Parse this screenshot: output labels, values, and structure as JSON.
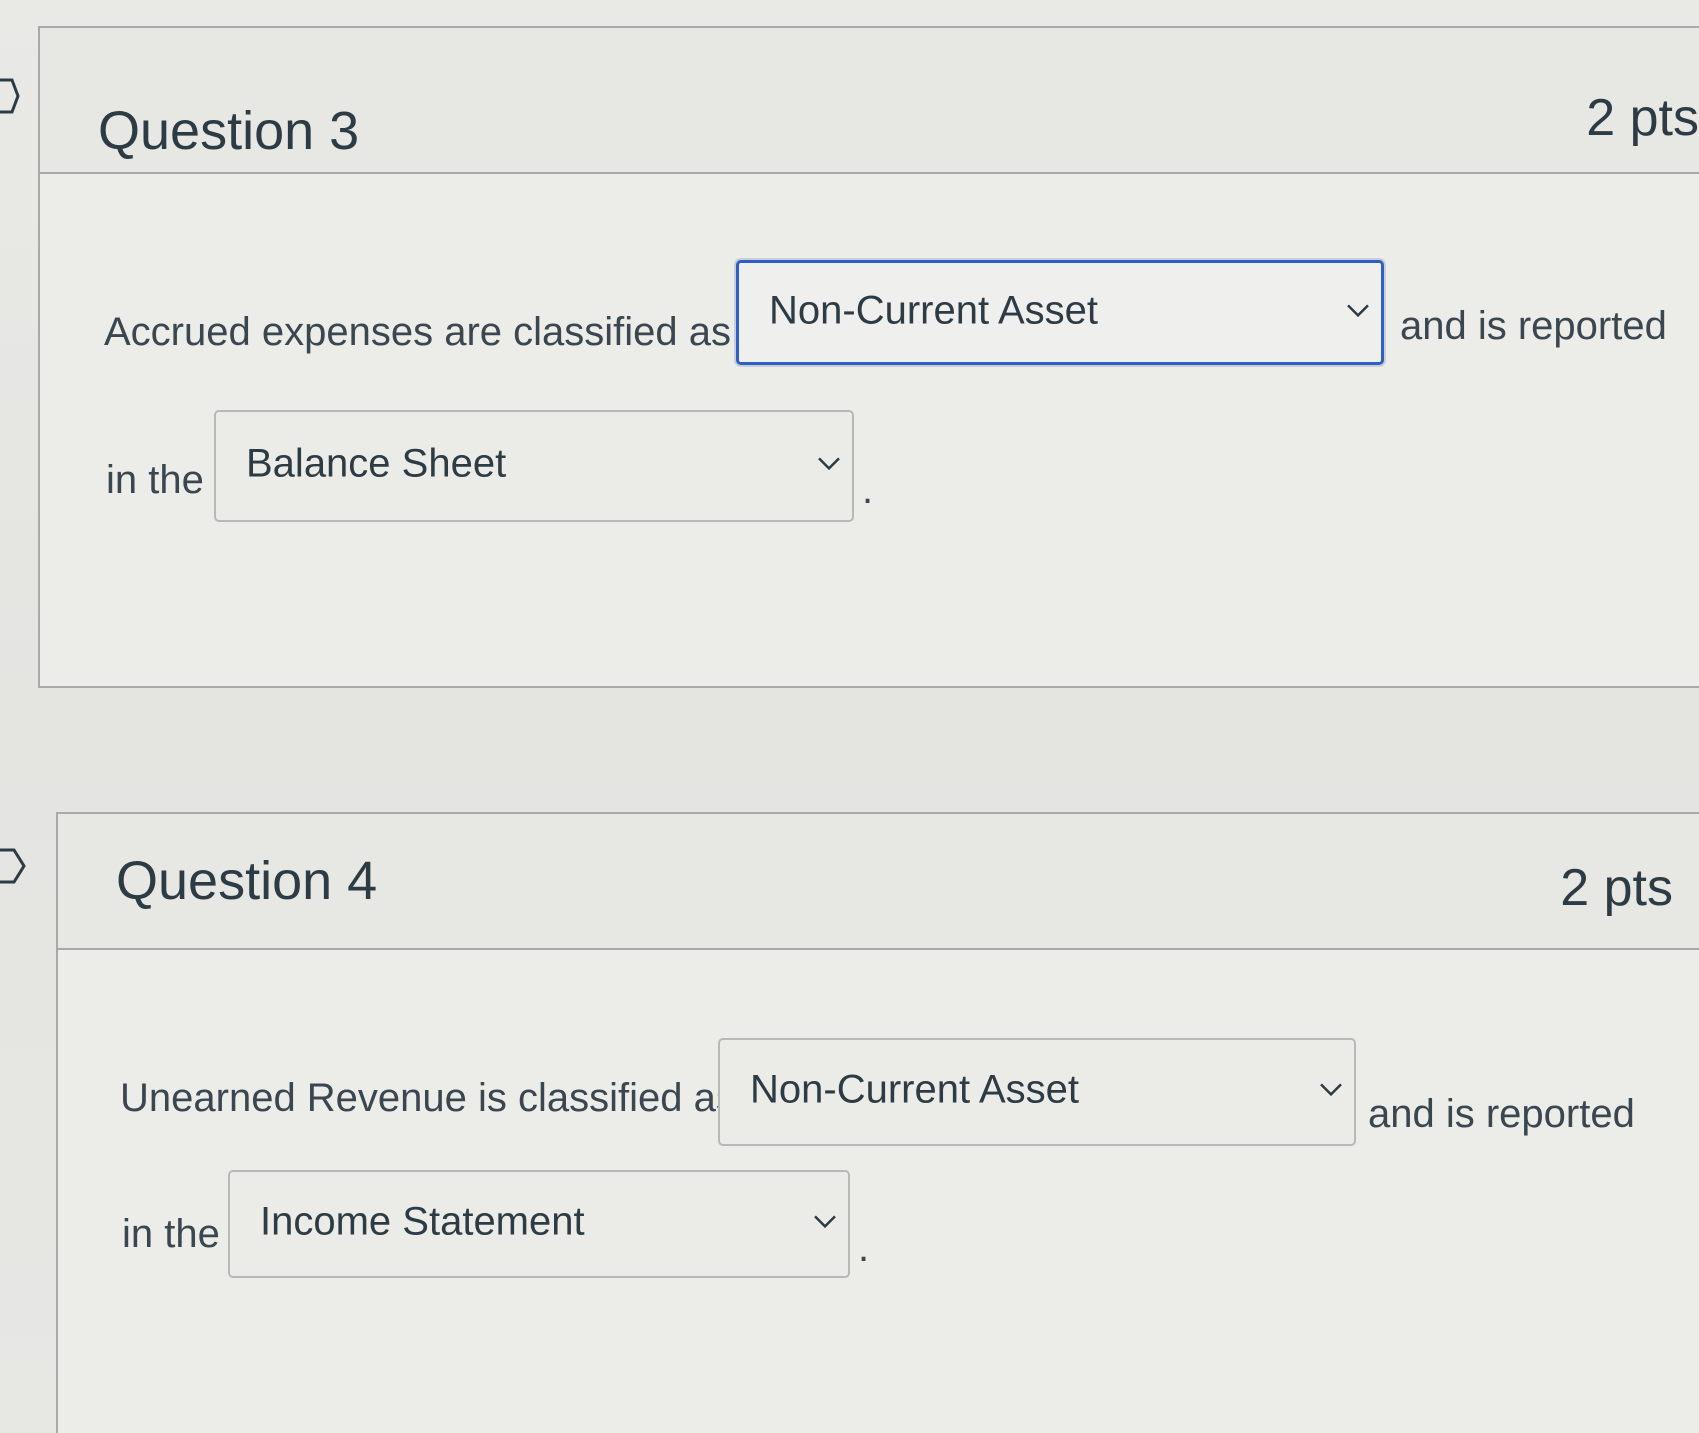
{
  "questions": [
    {
      "title": "Question 3",
      "points": "2 pts",
      "sentence_part1": "Accrued expenses are classified as a",
      "dropdown1_value": "Non-Current Asset",
      "sentence_part2": "and is reported",
      "sentence_part3": "in the",
      "dropdown2_value": "Balance Sheet",
      "sentence_end": "."
    },
    {
      "title": "Question 4",
      "points": "2 pts",
      "sentence_part1": "Unearned Revenue is classified as a",
      "dropdown1_value": "Non-Current Asset",
      "sentence_part2": "and is reported",
      "sentence_part3": "in the",
      "dropdown2_value": "Income Statement",
      "sentence_end": "."
    }
  ],
  "colors": {
    "focus_border": "#2f5fc4",
    "text": "#2d3b45",
    "border": "#a9aaa7"
  },
  "icons": {
    "dropdown": "chevron-down-icon",
    "question_marker": "flag-outline-icon"
  }
}
